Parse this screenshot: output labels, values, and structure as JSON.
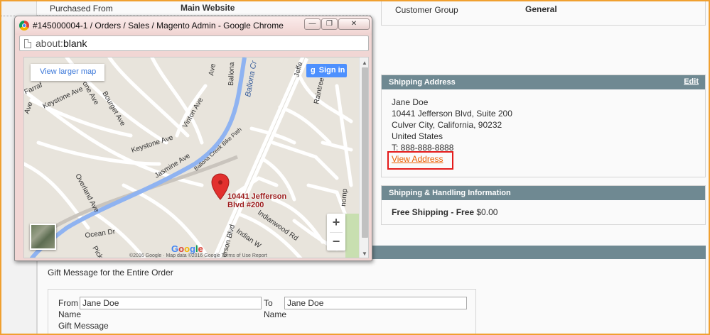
{
  "order_info": {
    "purchased_from_label": "Purchased From",
    "purchased_from_value": "Main Website"
  },
  "account_info": {
    "customer_group_label": "Customer Group",
    "customer_group_value": "General"
  },
  "shipping_address": {
    "title": "Shipping Address",
    "edit_label": "Edit",
    "name": "Jane Doe",
    "street": "10441 Jefferson Blvd, Suite 200",
    "city_line": "Culver City, California, 90232",
    "country": "United States",
    "phone": "T: 888-888-8888",
    "view_address_label": "View Address"
  },
  "shipping_handling": {
    "title": "Shipping & Handling Information",
    "method": "Free Shipping",
    "separator": " - ",
    "price_label": "Free",
    "price_value": " $0.00"
  },
  "gift_message": {
    "title": "Gift Message for the Entire Order",
    "from_label": "From",
    "from_sublabel": "Name",
    "from_value": "Jane Doe",
    "to_label": "To",
    "to_sublabel": "Name",
    "to_value": "Jane Doe",
    "message_label": "Gift Message"
  },
  "popup": {
    "window_title": "#145000004-1 / Orders / Sales / Magento Admin - Google Chrome",
    "url_scheme": "about:",
    "url_path": "blank",
    "minimize_glyph": "—",
    "restore_glyph": "❐",
    "close_glyph": "✕",
    "map": {
      "view_larger_label": "View larger map",
      "sign_in_g": "g",
      "sign_in_label": "Sign in",
      "pin_label_line1": "10441 Jefferson",
      "pin_label_line2": "Blvd #200",
      "zoom_in": "+",
      "zoom_out": "−",
      "google_letters": [
        "G",
        "o",
        "o",
        "g",
        "l",
        "e"
      ],
      "copyright": "©2016 Google · Map data ©2016 Google  Terms of Use  Report",
      "streets": {
        "bourget": "Bourget Ave",
        "ballona_creek": "Ballona Cr",
        "ballona": "Ballona",
        "jefferson": "Jeffe",
        "farragut": "Farraf",
        "keystone_top": "Keystone Ave",
        "one_ave": "one Ave",
        "vinton": "Vinton Ave",
        "keystone_mid": "Keystone Ave",
        "jasmine": "Jasmine Ave",
        "bike_path": "Ballona Creek Bike Path",
        "overland": "Overland Ave",
        "raintree": "Raintree Cir",
        "ocean": "Ocean Dr",
        "picke": "Picke",
        "erson": "erson Blvd",
        "indianwood": "Indianwood Rd",
        "indian_w": "Indian W",
        "ave_top": "Ave",
        "ave_side": "Ave",
        "thomp": "nomp"
      }
    }
  },
  "colors": {
    "panel_header": "#6f8992",
    "link_orange": "#eb5e00",
    "highlight_red": "#e41b1b",
    "frame_orange": "#f0a030"
  }
}
